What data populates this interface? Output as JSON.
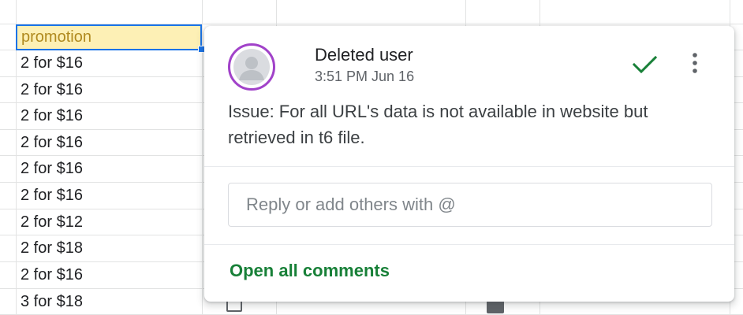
{
  "sheet": {
    "header_cell": "promotion",
    "rows": [
      "2 for $16",
      "2 for $16",
      "2 for $16",
      "2 for $16",
      "2 for $16",
      "2 for $16",
      "2 for $12",
      "2 for $18",
      "2 for $16",
      "3 for $18"
    ]
  },
  "comment": {
    "author": "Deleted user",
    "timestamp": "3:51 PM Jun 16",
    "text": "Issue: For all URL's data is not available in website but retrieved in t6 file.",
    "resolve_icon": "check-icon",
    "more_icon": "more-vert-icon",
    "reply_placeholder": "Reply or add others with @",
    "reply_value": "",
    "open_all_label": "Open all comments"
  },
  "colors": {
    "accent_green": "#188038",
    "selection_blue": "#1a73e8",
    "avatar_ring": "#a142c9",
    "header_fill": "#fdf0b5"
  }
}
